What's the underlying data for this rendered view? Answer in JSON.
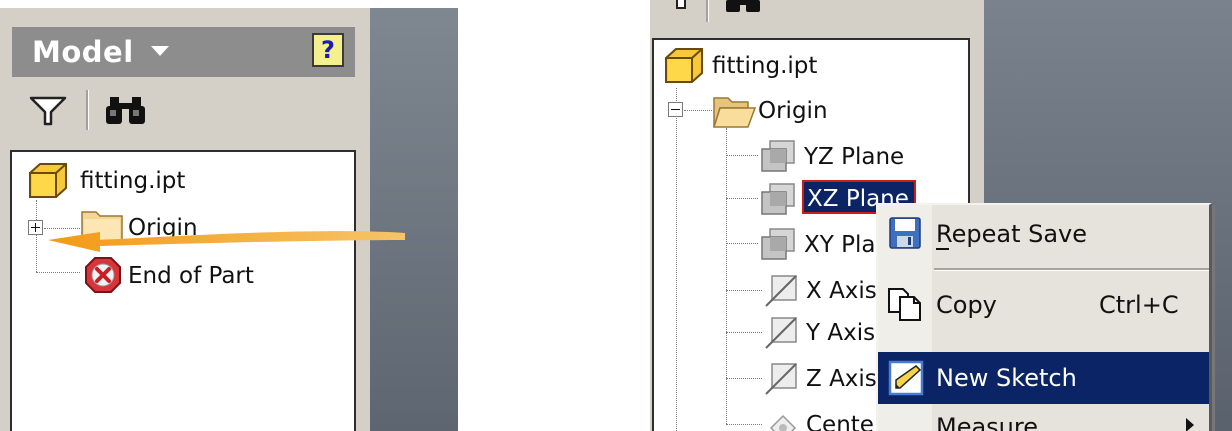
{
  "left_panel": {
    "header_title": "Model",
    "help_label": "?",
    "icons": [
      "filter-icon",
      "find-binoculars-icon"
    ],
    "tree": {
      "root": "fitting.ipt",
      "items": [
        {
          "label": "Origin",
          "icon": "folder-icon",
          "expander": "+"
        },
        {
          "label": "End of Part",
          "icon": "end-of-part-icon"
        }
      ]
    }
  },
  "right_panel": {
    "tree": {
      "root": "fitting.ipt",
      "folder": {
        "label": "Origin",
        "expander": "-"
      },
      "children": [
        {
          "label": "YZ Plane",
          "icon": "plane-icon"
        },
        {
          "label": "XZ Plane",
          "icon": "plane-icon",
          "selected": true
        },
        {
          "label": "XY Plane",
          "icon": "plane-icon"
        },
        {
          "label": "X Axis",
          "icon": "axis-icon"
        },
        {
          "label": "Y Axis",
          "icon": "axis-icon"
        },
        {
          "label": "Z Axis",
          "icon": "axis-icon"
        },
        {
          "label": "Center Point",
          "icon": "center-point-icon"
        }
      ]
    },
    "context_menu": {
      "items": [
        {
          "label": "Repeat Save",
          "accel": "R",
          "icon": "save-icon"
        },
        {
          "label": "Copy",
          "shortcut": "Ctrl+C",
          "icon": "copy-icon"
        },
        {
          "label": "New Sketch",
          "icon": "new-sketch-icon",
          "highlighted": true
        },
        {
          "label": "Measure",
          "submenu": true
        }
      ]
    }
  },
  "colors": {
    "panel": "#d4d0c8",
    "header": "#8d8d8d",
    "selection": "#0a2465",
    "arrow": "#f0a020",
    "background": "#5d6670"
  }
}
